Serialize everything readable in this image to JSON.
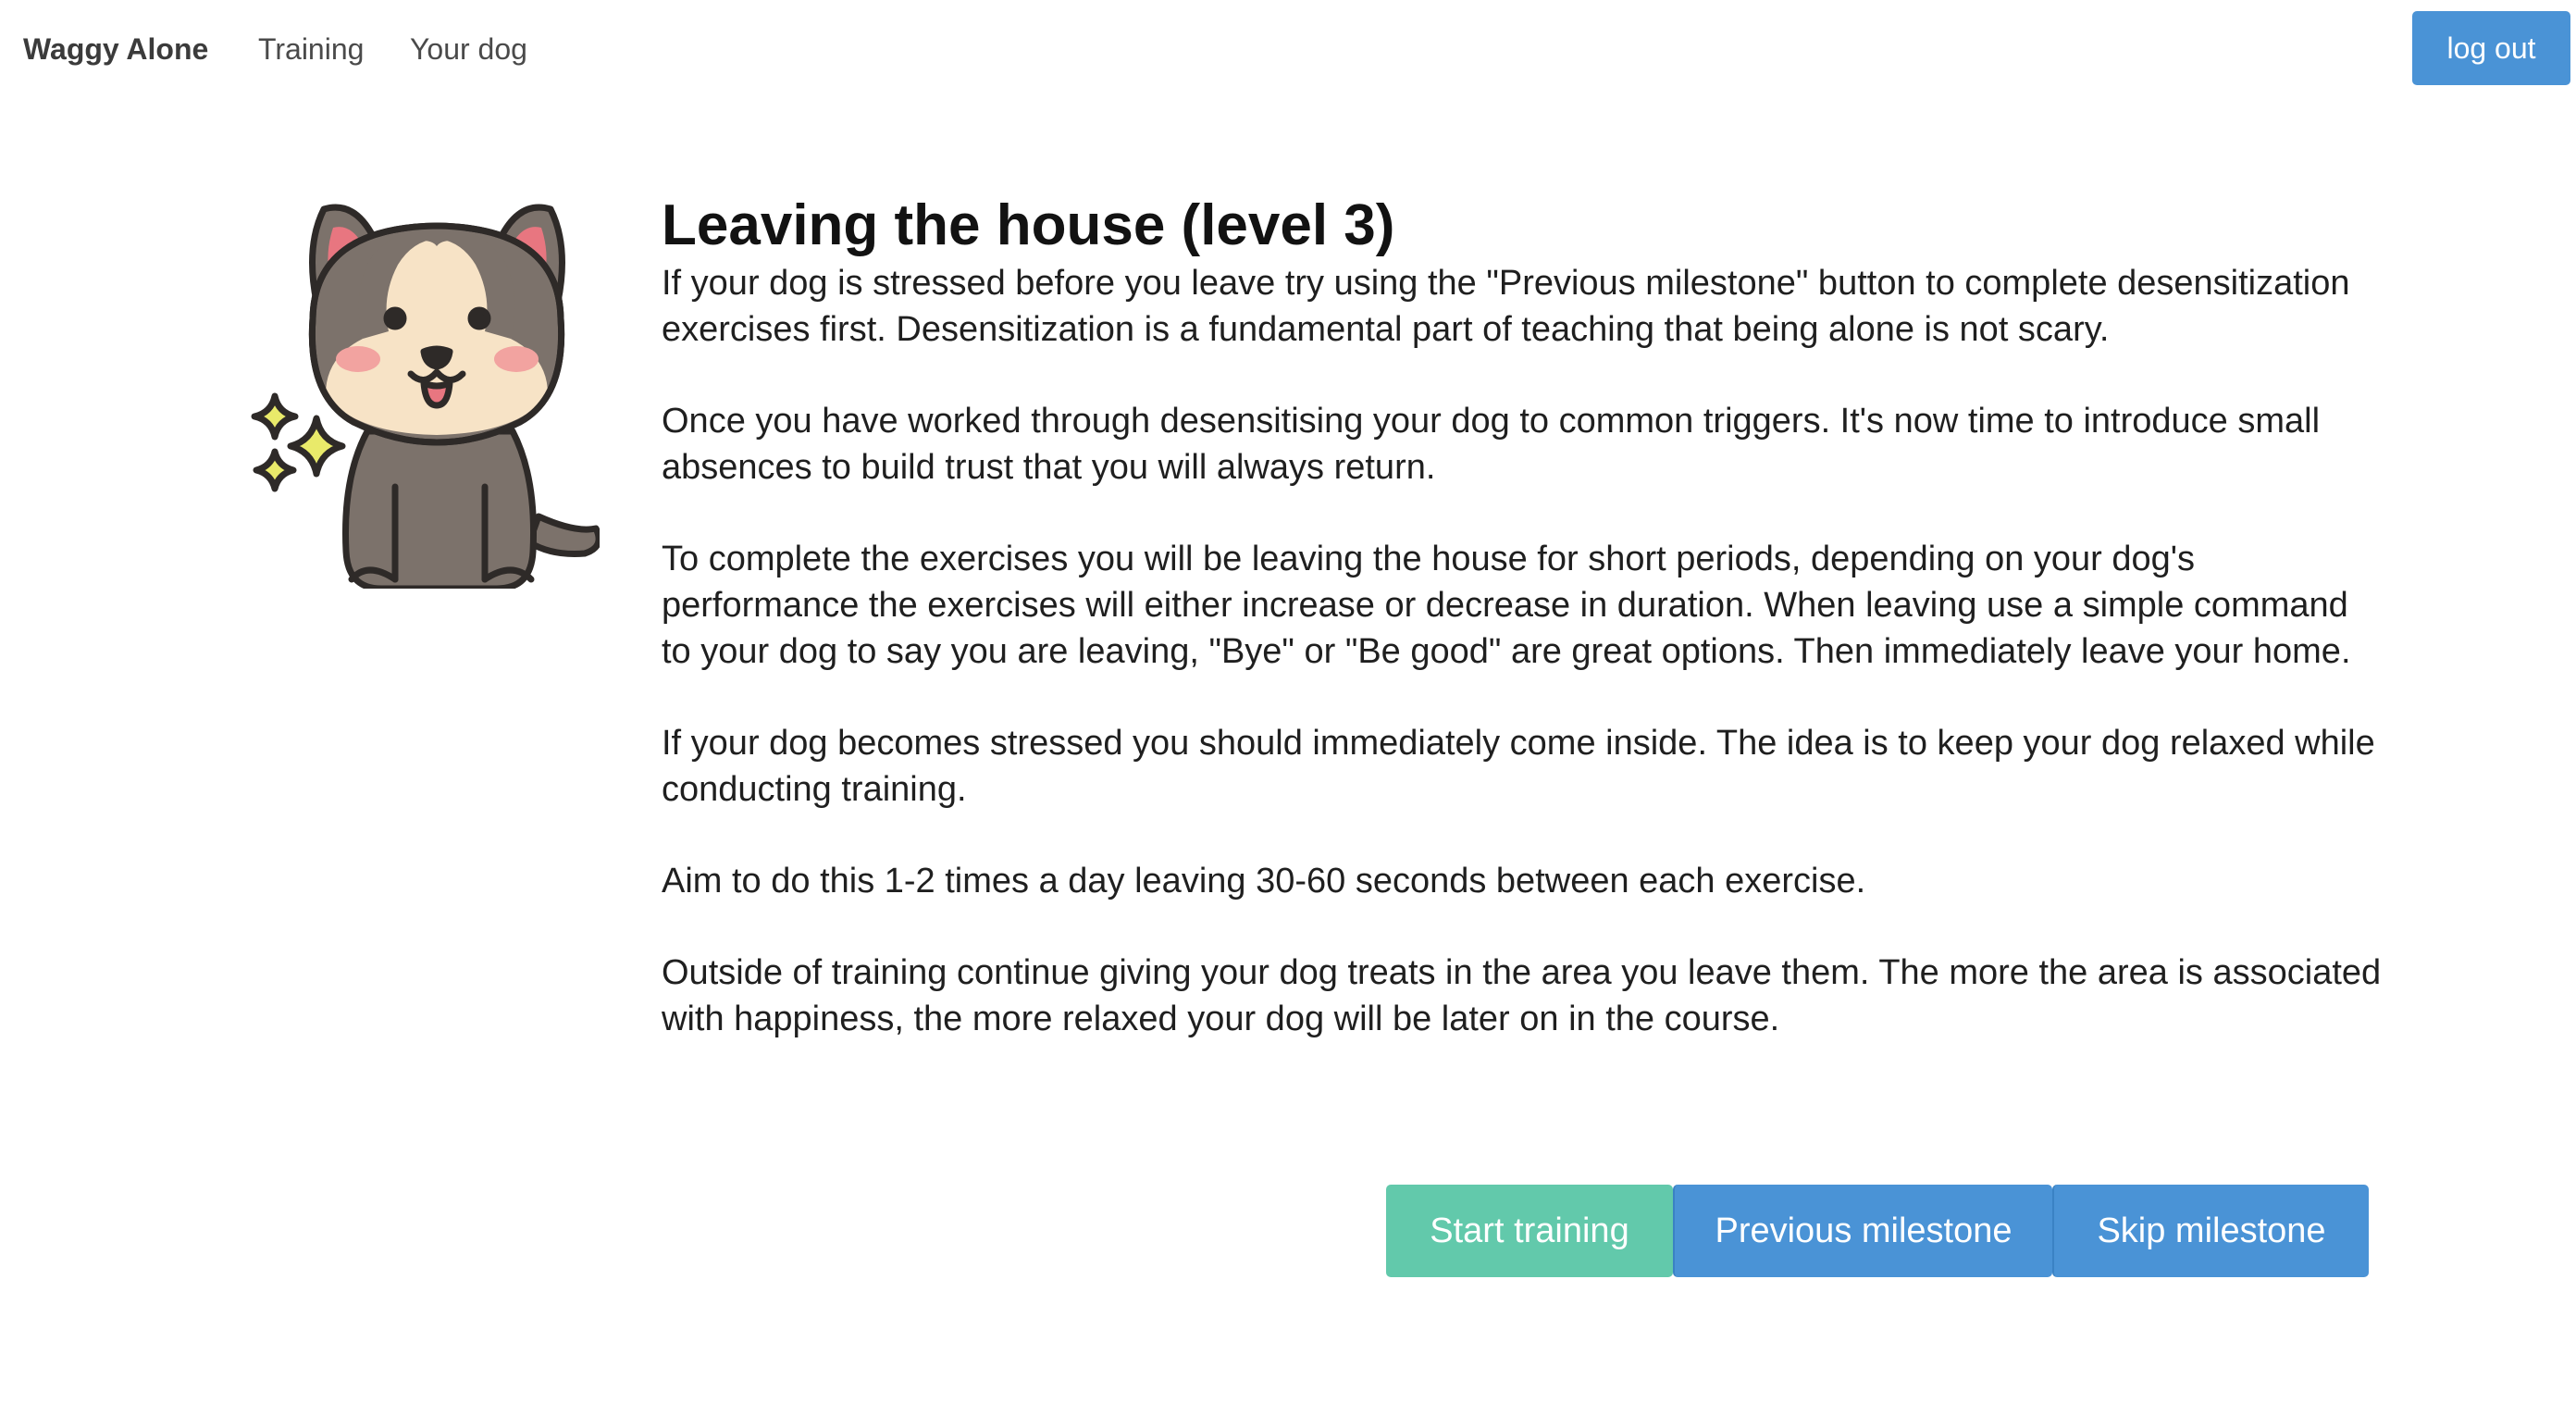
{
  "nav": {
    "brand": "Waggy Alone",
    "links": [
      "Training",
      "Your dog"
    ],
    "logout_label": "log out"
  },
  "colors": {
    "primary": "#4a93d6",
    "success": "#62c9ab",
    "text": "#1f1f1f"
  },
  "main": {
    "mascot_icon": "cartoon-dog-icon",
    "title": "Leaving the house (level 3)",
    "paragraphs": [
      "If your dog is stressed before you leave try using the \"Previous milestone\" button to complete desensitization exercises first. Desensitization is a fundamental part of teaching that being alone is not scary.",
      "Once you have worked through desensitising your dog to common triggers. It's now time to introduce small absences to build trust that you will always return.",
      "To complete the exercises you will be leaving the house for short periods, depending on your dog's performance the exercises will either increase or decrease in duration. When leaving use a simple command to your dog to say you are leaving, \"Bye\" or \"Be good\" are great options. Then immediately leave your home.",
      "If your dog becomes stressed you should immediately come inside. The idea is to keep your dog relaxed while conducting training.",
      "Aim to do this 1-2 times a day leaving 30-60 seconds between each exercise.",
      "Outside of training continue giving your dog treats in the area you leave them. The more the area is associated with happiness, the more relaxed your dog will be later on in the course."
    ],
    "buttons": {
      "start": "Start training",
      "previous": "Previous milestone",
      "skip": "Skip milestone"
    }
  }
}
